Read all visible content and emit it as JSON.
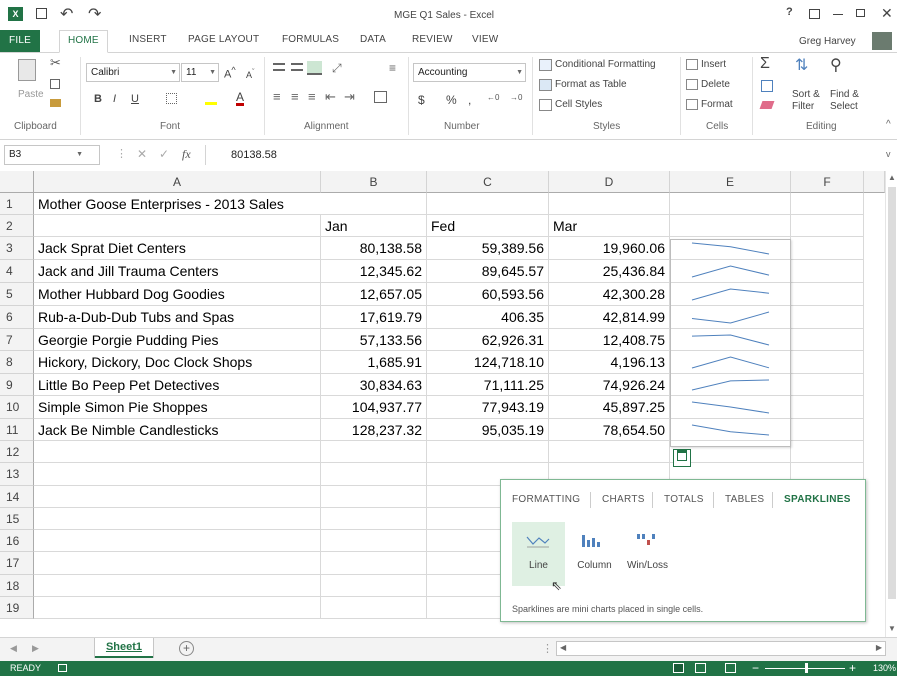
{
  "window": {
    "title": "MGE Q1 Sales - Excel",
    "help": "?",
    "user": "Greg Harvey"
  },
  "qat": {
    "undo": "↶",
    "redo": "↷"
  },
  "tabs": [
    "FILE",
    "HOME",
    "INSERT",
    "PAGE LAYOUT",
    "FORMULAS",
    "DATA",
    "REVIEW",
    "VIEW"
  ],
  "ribbon": {
    "clipboard": {
      "paste": "Paste",
      "label": "Clipboard"
    },
    "font": {
      "name": "Calibri",
      "size": "11",
      "label": "Font",
      "bold": "B",
      "italic": "I",
      "underline": "U"
    },
    "alignment": {
      "label": "Alignment"
    },
    "number": {
      "format": "Accounting",
      "label": "Number",
      "currency": "$",
      "percent": "%",
      "comma": ","
    },
    "styles": {
      "cond": "Conditional Formatting",
      "table": "Format as Table",
      "cell": "Cell Styles",
      "label": "Styles"
    },
    "cells": {
      "insert": "Insert",
      "delete": "Delete",
      "format": "Format",
      "label": "Cells"
    },
    "editing": {
      "sort1": "Sort &",
      "sort2": "Filter",
      "find1": "Find &",
      "find2": "Select",
      "label": "Editing"
    }
  },
  "formula_bar": {
    "namebox": "B3",
    "fx": "fx",
    "value": "80138.58"
  },
  "columns": [
    "A",
    "B",
    "C",
    "D",
    "E",
    "F"
  ],
  "rows": [
    "1",
    "2",
    "3",
    "4",
    "5",
    "6",
    "7",
    "8",
    "9",
    "10",
    "11",
    "12",
    "13",
    "14",
    "15",
    "16",
    "17",
    "18",
    "19"
  ],
  "sheet": {
    "title": "Mother Goose Enterprises - 2013 Sales",
    "headers": [
      "Jan",
      "Fed",
      "Mar"
    ],
    "data": [
      {
        "name": "Jack Sprat Diet Centers",
        "jan": "80,138.58",
        "feb": "59,389.56",
        "mar": "19,960.06",
        "spark": [
          80138.58,
          59389.56,
          19960.06
        ]
      },
      {
        "name": "Jack and Jill Trauma Centers",
        "jan": "12,345.62",
        "feb": "89,645.57",
        "mar": "25,436.84",
        "spark": [
          12345.62,
          89645.57,
          25436.84
        ]
      },
      {
        "name": "Mother Hubbard Dog Goodies",
        "jan": "12,657.05",
        "feb": "60,593.56",
        "mar": "42,300.28",
        "spark": [
          12657.05,
          60593.56,
          42300.28
        ]
      },
      {
        "name": "Rub-a-Dub-Dub Tubs and Spas",
        "jan": "17,619.79",
        "feb": "406.35",
        "mar": "42,814.99",
        "spark": [
          17619.79,
          406.35,
          42814.99
        ]
      },
      {
        "name": "Georgie Porgie Pudding Pies",
        "jan": "57,133.56",
        "feb": "62,926.31",
        "mar": "12,408.75",
        "spark": [
          57133.56,
          62926.31,
          12408.75
        ]
      },
      {
        "name": "Hickory, Dickory, Doc Clock Shops",
        "jan": "1,685.91",
        "feb": "124,718.10",
        "mar": "4,196.13",
        "spark": [
          1685.91,
          124718.1,
          4196.13
        ]
      },
      {
        "name": "Little Bo Peep Pet Detectives",
        "jan": "30,834.63",
        "feb": "71,111.25",
        "mar": "74,926.24",
        "spark": [
          30834.63,
          71111.25,
          74926.24
        ]
      },
      {
        "name": "Simple Simon Pie Shoppes",
        "jan": "104,937.77",
        "feb": "77,943.19",
        "mar": "45,897.25",
        "spark": [
          104937.77,
          77943.19,
          45897.25
        ]
      },
      {
        "name": "Jack Be Nimble Candlesticks",
        "jan": "128,237.32",
        "feb": "95,035.19",
        "mar": "78,654.50",
        "spark": [
          128237.32,
          95035.19,
          78654.5
        ]
      }
    ]
  },
  "quick_analysis": {
    "tabs": [
      "FORMATTING",
      "CHARTS",
      "TOTALS",
      "TABLES",
      "SPARKLINES"
    ],
    "active": "SPARKLINES",
    "options": [
      "Line",
      "Column",
      "Win/Loss"
    ],
    "description": "Sparklines are mini charts placed in single cells."
  },
  "sheets": {
    "tab": "Sheet1",
    "add": "+"
  },
  "status": {
    "mode": "READY",
    "zoom": "130%"
  },
  "colors": {
    "accent": "#217346",
    "sparkline": "#4f81bd",
    "hover": "#dff0e3"
  }
}
